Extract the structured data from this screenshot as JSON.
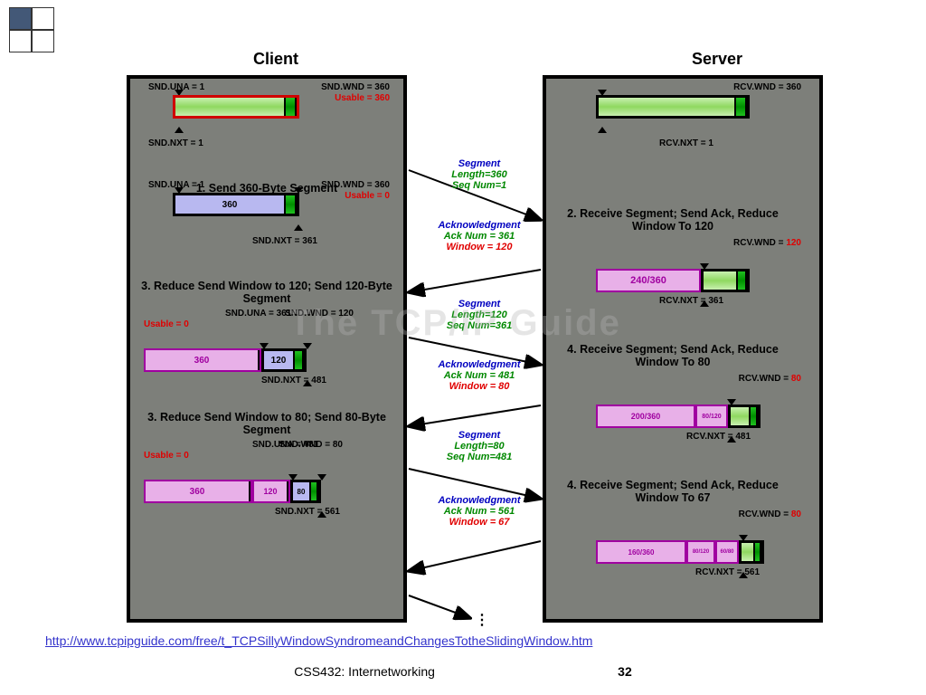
{
  "header": {
    "client": "Client",
    "server": "Server"
  },
  "client": {
    "s1": {
      "title": "1. Send 360-Byte Segment",
      "labels": {
        "una": "SND.UNA = 1",
        "wnd": "SND.WND = 360",
        "usable": "Usable = 360",
        "nxt": "SND.NXT = 1"
      }
    },
    "s2": {
      "labels": {
        "una": "SND.UNA = 1",
        "wnd": "SND.WND = 360",
        "usable": "Usable = 0",
        "nxt": "SND.NXT = 361"
      },
      "bar": "360"
    },
    "s3": {
      "title": "3. Reduce Send Window to 120; Send 120-Byte Segment",
      "labels": {
        "una": "SND.UNA = 361",
        "wnd": "SND.WND = 120",
        "usable": "Usable = 0",
        "nxt": "SND.NXT = 481"
      },
      "bar1": "360",
      "bar2": "120"
    },
    "s4": {
      "title": "3. Reduce Send Window to 80; Send 80-Byte Segment",
      "labels": {
        "una": "SND.UNA = 481",
        "wnd": "SND.WND = 80",
        "usable": "Usable = 0",
        "nxt": "SND.NXT = 561"
      },
      "bar1": "360",
      "bar2": "120",
      "bar3": "80"
    }
  },
  "server": {
    "s1": {
      "labels": {
        "wnd": "RCV.WND = 360",
        "nxt": "RCV.NXT = 1"
      }
    },
    "s2": {
      "title": "2. Receive Segment; Send Ack, Reduce Window To 120",
      "labels": {
        "wnd": "RCV.WND = 120",
        "nxt": "RCV.NXT = 361"
      },
      "bar": "240/360"
    },
    "s3": {
      "title": "4. Receive Segment; Send Ack, Reduce Window To 80",
      "labels": {
        "wnd": "RCV.WND = 80",
        "nxt": "RCV.NXT = 481"
      },
      "bar1": "200/360",
      "bar2": "80/120"
    },
    "s4": {
      "title": "4. Receive Segment; Send Ack, Reduce Window To 67",
      "labels": {
        "wnd": "RCV.WND = 80",
        "nxt": "RCV.NXT = 561"
      },
      "bar1": "160/360",
      "bar2": "80/120",
      "bar3": "60/80"
    }
  },
  "messages": {
    "seg1": {
      "h": "Segment",
      "l1": "Length=360",
      "l2": "Seq Num=1"
    },
    "ack1": {
      "h": "Acknowledgment",
      "l1": "Ack Num = 361",
      "l2": "Window = 120"
    },
    "seg2": {
      "h": "Segment",
      "l1": "Length=120",
      "l2": "Seq Num=361"
    },
    "ack2": {
      "h": "Acknowledgment",
      "l1": "Ack Num = 481",
      "l2": "Window = 80"
    },
    "seg3": {
      "h": "Segment",
      "l1": "Length=80",
      "l2": "Seq Num=481"
    },
    "ack3": {
      "h": "Acknowledgment",
      "l1": "Ack Num = 561",
      "l2": "Window = 67"
    }
  },
  "ellipsis": "⋮",
  "watermark": "The TCP/IP Guide",
  "url": "http://www.tcpipguide.com/free/t_TCPSillyWindowSyndromeandChangesTotheSlidingWindow.htm",
  "footer": {
    "course": "CSS432: Internetworking",
    "page": "32"
  }
}
